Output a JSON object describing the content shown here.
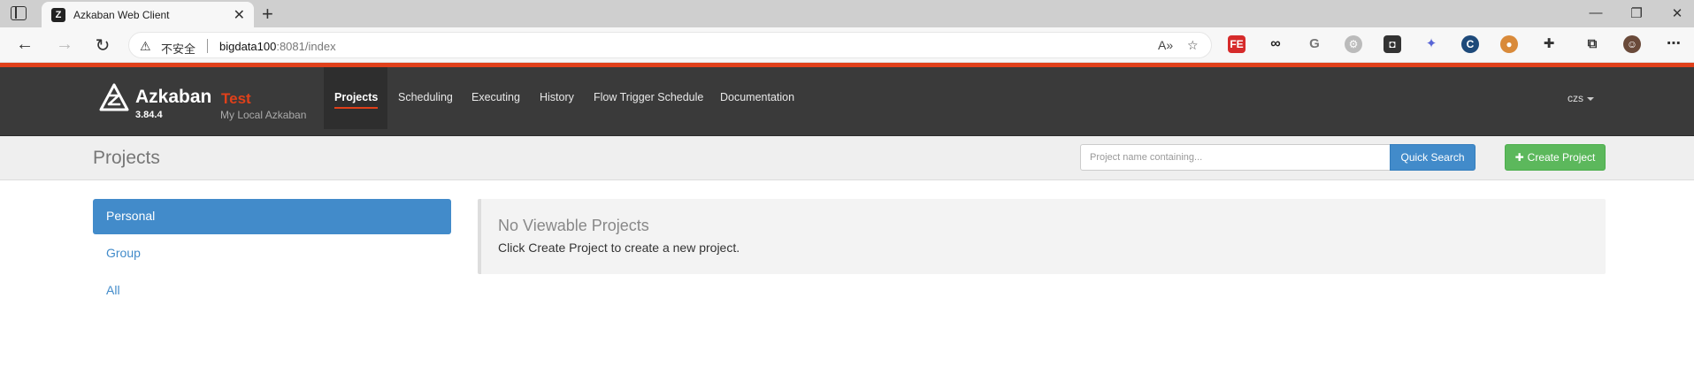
{
  "browser": {
    "tab_title": "Azkaban Web Client",
    "security_label": "不安全",
    "url_host": "bigdata100",
    "url_rest": ":8081/index"
  },
  "header": {
    "brand": "Azkaban",
    "environment": "Test",
    "version": "3.84.4",
    "subtitle": "My Local Azkaban",
    "nav": [
      {
        "label": "Projects",
        "active": true
      },
      {
        "label": "Scheduling"
      },
      {
        "label": "Executing"
      },
      {
        "label": "History"
      },
      {
        "label": "Flow Trigger Schedule"
      },
      {
        "label": "Documentation"
      }
    ],
    "user": "czs"
  },
  "titlebar": {
    "title": "Projects",
    "search_placeholder": "Project name containing...",
    "search_button": "Quick Search",
    "create_button": "Create Project"
  },
  "filters": [
    {
      "label": "Personal",
      "active": true
    },
    {
      "label": "Group"
    },
    {
      "label": "All"
    }
  ],
  "empty": {
    "title": "No Viewable Projects",
    "message": "Click Create Project to create a new project."
  },
  "colors": {
    "accent_red": "#e0401a",
    "primary_blue": "#428bca",
    "success_green": "#5cb85c",
    "header_dark": "#3a3a3a"
  }
}
